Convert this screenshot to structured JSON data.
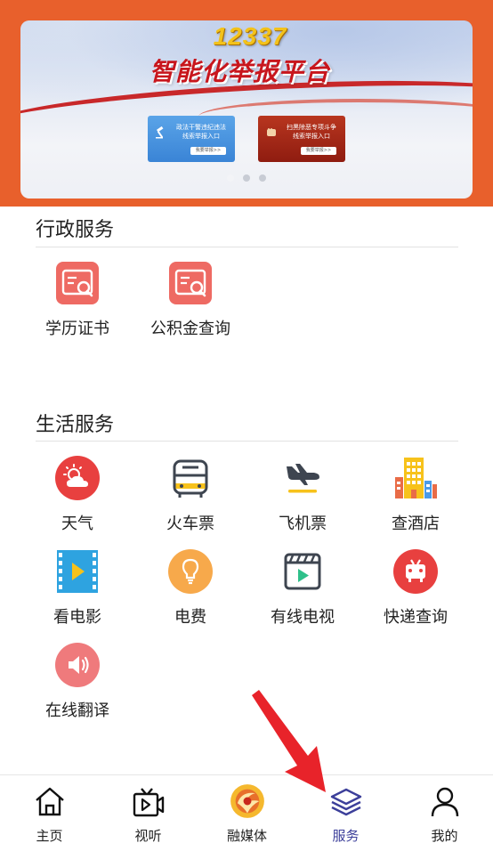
{
  "banner": {
    "hotline": "12337",
    "title": "智能化举报平台",
    "card_left": {
      "text": "政法干警违纪违法\n线索举报入口",
      "button": "我要举报>>"
    },
    "card_right": {
      "text": "扫黑除恶专项斗争\n线索举报入口",
      "button": "我要举报>>"
    },
    "slides": 3,
    "active_slide": 0
  },
  "admin_services": {
    "title": "行政服务",
    "items": [
      {
        "label": "学历证书",
        "icon": "certificate-search-icon"
      },
      {
        "label": "公积金查询",
        "icon": "fund-search-icon"
      }
    ]
  },
  "life_services": {
    "title": "生活服务",
    "items": [
      {
        "label": "天气",
        "icon": "weather-icon"
      },
      {
        "label": "火车票",
        "icon": "train-icon"
      },
      {
        "label": "飞机票",
        "icon": "airplane-icon"
      },
      {
        "label": "查酒店",
        "icon": "hotel-icon"
      },
      {
        "label": "看电影",
        "icon": "movie-icon"
      },
      {
        "label": "电费",
        "icon": "lightbulb-icon"
      },
      {
        "label": "有线电视",
        "icon": "cable-tv-icon"
      },
      {
        "label": "快递查询",
        "icon": "delivery-icon"
      },
      {
        "label": "在线翻译",
        "icon": "translate-speaker-icon"
      }
    ]
  },
  "tabbar": {
    "items": [
      {
        "label": "主页",
        "icon": "home-icon"
      },
      {
        "label": "视听",
        "icon": "video-icon"
      },
      {
        "label": "融媒体",
        "icon": "media-logo-icon"
      },
      {
        "label": "服务",
        "icon": "layers-icon",
        "active": true
      },
      {
        "label": "我的",
        "icon": "person-icon"
      }
    ]
  },
  "colors": {
    "header_orange": "#e8602c",
    "accent_active": "#3c3f9a",
    "pointer_red": "#e8232a"
  }
}
